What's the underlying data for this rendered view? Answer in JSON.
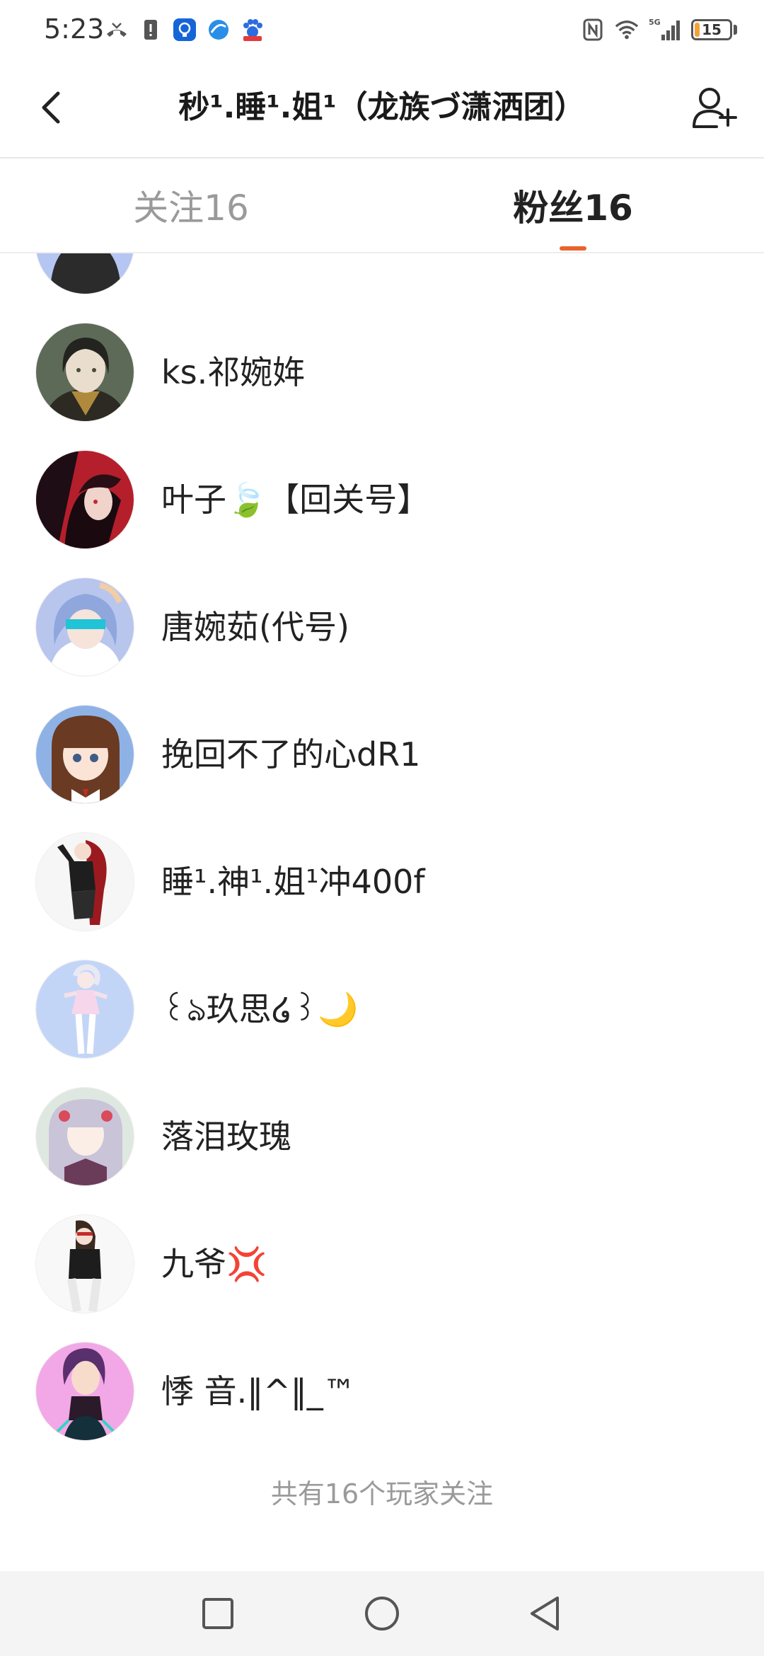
{
  "status_bar": {
    "time": "5:23",
    "network": "5G",
    "battery": "15",
    "battery_level": 0.15
  },
  "header": {
    "title": "秒¹.睡¹.姐¹（龙族づ潇洒团）",
    "back_icon": "chevron-left-icon",
    "add_icon": "add-user-icon"
  },
  "tabs": [
    {
      "label": "关注16",
      "active": false
    },
    {
      "label": "粉丝16",
      "active": true
    }
  ],
  "followers": [
    {
      "name": "",
      "avatar_color": "#b6c6f2"
    },
    {
      "name": "ks.祁婉姩",
      "avatar_color": "#5e6a58"
    },
    {
      "name": "叶子🍃【回关号】",
      "avatar_color": "#b41f2b"
    },
    {
      "name": "唐婉茹(代号)",
      "avatar_color": "#b8c6ee"
    },
    {
      "name": "挽回不了的心dR1",
      "avatar_color": "#8fb2e6"
    },
    {
      "name": "睡¹.神¹.姐¹冲400f",
      "avatar_color": "#f6f6f6"
    },
    {
      "name": "꒰ঌ玖思໒꒱🌙",
      "avatar_color": "#c3d5f7"
    },
    {
      "name": "落泪玫瑰",
      "avatar_color": "#dfe8e0"
    },
    {
      "name": "九爷💢",
      "avatar_color": "#f8f8f8"
    },
    {
      "name": "悸  音.‖^‖_™",
      "avatar_color": "#f2a8e6"
    }
  ],
  "footer": {
    "summary": "共有16个玩家关注"
  },
  "colors": {
    "accent": "#e8642c",
    "tab_inactive": "#9a9a9a",
    "text_primary": "#222222"
  }
}
